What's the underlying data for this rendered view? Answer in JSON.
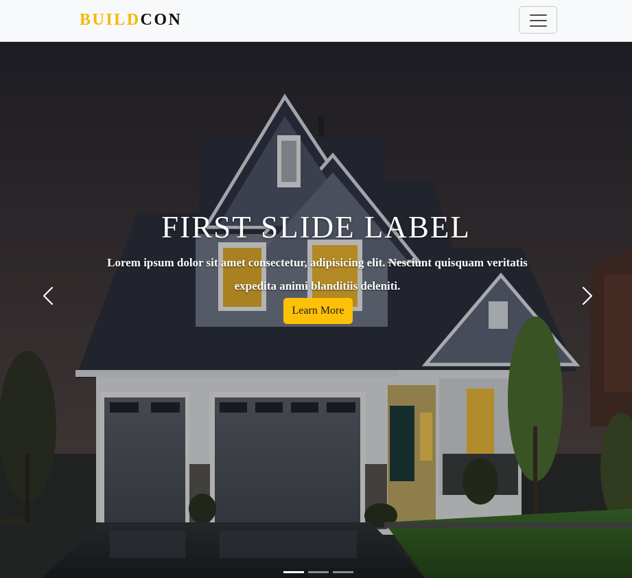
{
  "navbar": {
    "brand_part1": "BUILD",
    "brand_part2": "CON",
    "toggler_icon": "hamburger-menu-icon"
  },
  "carousel": {
    "slide": {
      "title": "FIRST SLIDE LABEL",
      "text": "Lorem ipsum dolor sit amet consectetur, adipisicing elit. Nesciunt quisquam veritatis expedita animi blanditiis deleniti.",
      "button_label": "Learn More",
      "image": "house-at-dusk-photo"
    },
    "prev_icon": "chevron-left-icon",
    "next_icon": "chevron-right-icon",
    "indicator_count": 3,
    "active_indicator": 1
  },
  "colors": {
    "accent": "#ffc107",
    "brand_yellow": "#f5b800",
    "navbar_bg": "#f8f9fa",
    "text_dark": "#111111",
    "caption_text": "#ffffff"
  }
}
